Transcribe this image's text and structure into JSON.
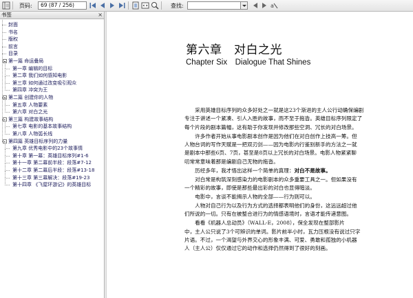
{
  "toolbar": {
    "page_label": "页码:",
    "page_value": "69 (87 / 256)",
    "search_label": "查找:",
    "search_value": "",
    "icons": [
      "first-page-icon",
      "prev-page-icon",
      "next-page-icon",
      "last-page-icon",
      "fit-page-icon",
      "fit-width-icon",
      "zoom-icon",
      "find-prev-icon",
      "find-next-icon",
      "match-case-icon"
    ]
  },
  "sidebar": {
    "title": "书签",
    "close": "×",
    "items": [
      {
        "label": "封面",
        "level": 1
      },
      {
        "label": "书名",
        "level": 1
      },
      {
        "label": "版权",
        "level": 1
      },
      {
        "label": "前言",
        "level": 1
      },
      {
        "label": "目录",
        "level": 1
      },
      {
        "label": "第一篇 命运叠局",
        "level": 1,
        "expanded": true
      },
      {
        "label": "第一章 编辑的目标",
        "level": 2
      },
      {
        "label": "第二章 我们如何感知电影",
        "level": 2
      },
      {
        "label": "第三章 如何通过改变吸引观众",
        "level": 2
      },
      {
        "label": "第四章 冲突为王",
        "level": 2
      },
      {
        "label": "第二篇 创建你的人物",
        "level": 1,
        "expanded": true
      },
      {
        "label": "第五章 人物要素",
        "level": 2
      },
      {
        "label": "第六章 对白之光",
        "level": 2
      },
      {
        "label": "第三篇 构建故事结构",
        "level": 1,
        "expanded": true
      },
      {
        "label": "第七章 电影的基本故事结构",
        "level": 2
      },
      {
        "label": "第八章 人物弧长线",
        "level": 2
      },
      {
        "label": "第四篇 英雄目标序列的力量",
        "level": 1,
        "expanded": true
      },
      {
        "label": "第九章 优秀电影中的23个故事情",
        "level": 2
      },
      {
        "label": "第十章 第一幕：英雄目标序列#1-6",
        "level": 2
      },
      {
        "label": "第十一章 第二幕前半段：段落#7-12",
        "level": 2
      },
      {
        "label": "第十二章 第二幕后半段：段落#13-18",
        "level": 2
      },
      {
        "label": "第十三章 第三幕解决：段落#19-23",
        "level": 2
      },
      {
        "label": "第十四章 《飞屋环游记》的英雄目标",
        "level": 2
      }
    ]
  },
  "document": {
    "chapter_title": "第六章　对白之光",
    "chapter_subtitle": "Chapter Six　Dialogue That Shines",
    "paragraphs": [
      {
        "lines": [
          "　　采用英雄目标序列的众多好处之一就是这23个渐进的主人公行动确保编剧",
          "专注于讲述一个紧凑、引人入胜的故事，而不至于拖沓。英雄目标序列限定了",
          "每个片段的剧本篇幅，这有助于你发现并修改那些空洞、冗长的对白场景。"
        ]
      },
      {
        "lines": [
          "　　许多作者开始从事电影剧本创作是因为他们在对白创作上技高一筹。但",
          "人物台词的写作天赋是一把双刃剑——因为电影内行鉴别新手的方法之一就",
          "是剧本中那些6页、7页，甚至是8页以上冗长的对白场景。电影人物紧紧聊",
          "叨常常意味着那是编剧自己无物的拖沓。"
        ]
      },
      {
        "lines": [
          "　　历经多年，我才悟出这样一个简单的真理：对白不是故事。"
        ],
        "bold_tail": "对白不是故事。"
      },
      {
        "lines": [
          "　　对白常是构筑深刻感染力的电影剧本的众多重要工具之一。但如果没有",
          "一个精彩的故事，即使是那些最出彩的对白也显得暗淡。"
        ]
      },
      {
        "lines": [
          "　　电影中，言谈不能揭示人物的全部——行为则可以。"
        ]
      },
      {
        "lines": [
          "　　人物对自己行为以及行为方式的选择都表明他们的身份，这远远超过他",
          "们所说的一切。只有在被整合进行为的情感语境时，言语才能传递意图。"
        ]
      },
      {
        "lines": [
          "　　看看《机器人总动员》（WALL-E，2008），保全发现在整部影片",
          "中，主人公只说了3个可辨识的单词。影片前半小时，瓦力压根没有说过只字",
          "片语。不过，一个渴望与外界交心的形象丰满、可爱、勇敢和孤独的小机器",
          "人（主人公）仅仅通过它的动作和选择仍然得到了很好的刻画。"
        ]
      }
    ]
  }
}
